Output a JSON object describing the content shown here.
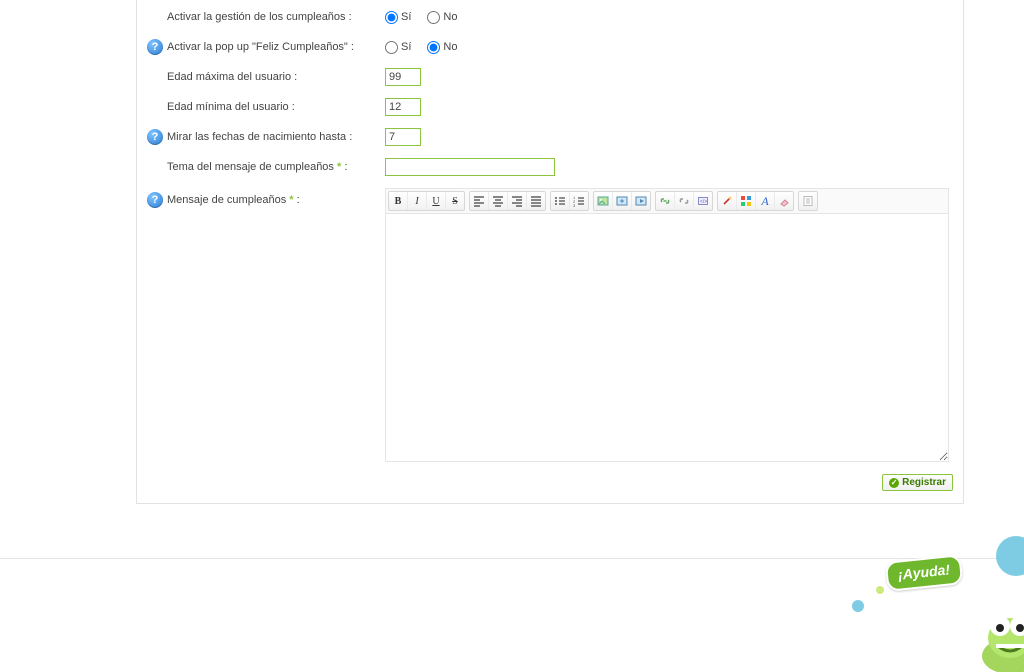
{
  "rows": {
    "activar_gestion": {
      "label": "Activar la gestión de los cumpleaños :",
      "yes": "Sí",
      "no": "No"
    },
    "activar_popup": {
      "label": "Activar la pop up \"Feliz Cumpleaños\" :",
      "yes": "Sí",
      "no": "No"
    },
    "edad_max": {
      "label": "Edad máxima del usuario :",
      "value": "99"
    },
    "edad_min": {
      "label": "Edad mínima del usuario :",
      "value": "12"
    },
    "mirar_fechas": {
      "label": "Mirar las fechas de nacimiento hasta :",
      "value": "7"
    },
    "tema": {
      "label": "Tema del mensaje de cumpleaños ",
      "value": ""
    },
    "mensaje": {
      "label": "Mensaje de cumpleaños "
    }
  },
  "misc": {
    "required_marker": "*",
    "colon": " :"
  },
  "submit": {
    "label": "Registrar"
  },
  "help_glyph": "?",
  "ayuda": {
    "label": "¡Ayuda!"
  },
  "radio_state": {
    "activar_gestion": "yes",
    "activar_popup": "no"
  }
}
